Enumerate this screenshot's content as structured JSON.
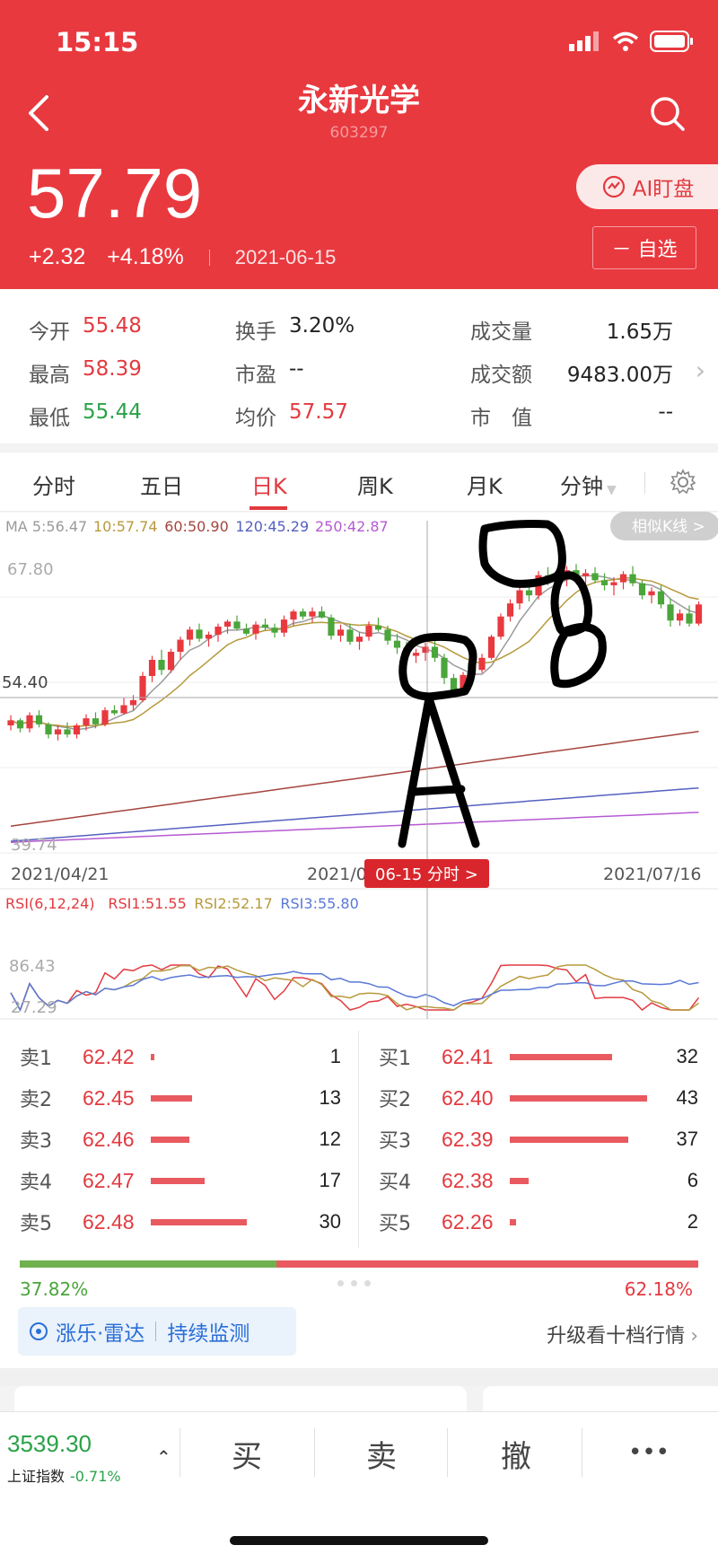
{
  "status": {
    "time": "15:15"
  },
  "header": {
    "title": "永新光学",
    "code": "603297",
    "price": "57.79",
    "change": "+2.32",
    "change_pct": "+4.18%",
    "date": "2021-06-15",
    "ai_button": "AI盯盘",
    "watch_button": "－ 自选"
  },
  "stats": {
    "open_label": "今开",
    "open": "55.48",
    "high_label": "最高",
    "high": "58.39",
    "low_label": "最低",
    "low": "55.44",
    "turnover_label": "换手",
    "turnover": "3.20%",
    "pe_label": "市盈",
    "pe": "--",
    "avg_label": "均价",
    "avg": "57.57",
    "volume_label": "成交量",
    "volume": "1.65万",
    "amount_label": "成交额",
    "amount": "9483.00万",
    "mcap_label": "市　值",
    "mcap": "--"
  },
  "tabs": [
    "分时",
    "五日",
    "日K",
    "周K",
    "月K",
    "分钟"
  ],
  "chart_data": [
    {
      "type": "candlestick",
      "ma_legend": [
        {
          "label": "MA 5:56.47",
          "color": "#9a9a9a"
        },
        {
          "label": "10:57.74",
          "color": "#b69a3c"
        },
        {
          "label": "60:50.90",
          "color": "#a5453f"
        },
        {
          "label": "120:45.29",
          "color": "#5660c0"
        },
        {
          "label": "250:42.87",
          "color": "#b65ad3"
        }
      ],
      "y_ticks": [
        "67.80",
        "54.40",
        "39.74"
      ],
      "x_ticks": [
        "2021/04/21",
        "2021/0",
        "2021/07/16"
      ],
      "crosshair_label": "06-15 分时 >",
      "similar_button": "相似K线 >",
      "candles": [
        [
          51.5,
          52.5,
          51.0,
          52.0
        ],
        [
          52.0,
          52.2,
          50.8,
          51.2
        ],
        [
          51.2,
          52.8,
          50.8,
          52.5
        ],
        [
          52.5,
          53.0,
          51.3,
          51.6
        ],
        [
          51.6,
          51.8,
          50.2,
          50.6
        ],
        [
          50.6,
          51.5,
          50.0,
          51.1
        ],
        [
          51.1,
          51.8,
          50.3,
          50.6
        ],
        [
          50.6,
          51.7,
          50.2,
          51.5
        ],
        [
          51.5,
          52.6,
          51.0,
          52.2
        ],
        [
          52.2,
          52.8,
          51.2,
          51.6
        ],
        [
          51.6,
          53.3,
          51.4,
          53.0
        ],
        [
          53.0,
          53.5,
          52.5,
          52.7
        ],
        [
          52.7,
          54.2,
          52.6,
          53.5
        ],
        [
          53.5,
          54.5,
          53.0,
          54.0
        ],
        [
          54.0,
          56.8,
          53.8,
          56.4
        ],
        [
          56.4,
          58.4,
          55.8,
          58.0
        ],
        [
          58.0,
          59.0,
          56.5,
          57.0
        ],
        [
          57.0,
          59.1,
          56.7,
          58.8
        ],
        [
          58.8,
          60.3,
          58.0,
          60.0
        ],
        [
          60.0,
          61.3,
          59.4,
          61.0
        ],
        [
          61.0,
          61.6,
          59.8,
          60.1
        ],
        [
          60.1,
          60.8,
          59.3,
          60.5
        ],
        [
          60.5,
          61.6,
          59.8,
          61.3
        ],
        [
          61.3,
          62.0,
          60.6,
          61.8
        ],
        [
          61.8,
          62.4,
          60.9,
          61.1
        ],
        [
          61.1,
          61.6,
          60.4,
          60.6
        ],
        [
          60.6,
          61.8,
          60.0,
          61.5
        ],
        [
          61.5,
          62.1,
          60.9,
          61.2
        ],
        [
          61.2,
          61.6,
          60.2,
          60.7
        ],
        [
          60.7,
          62.4,
          60.3,
          62.0
        ],
        [
          62.0,
          63.0,
          61.4,
          62.8
        ],
        [
          62.8,
          63.1,
          62.0,
          62.3
        ],
        [
          62.3,
          63.2,
          61.7,
          62.8
        ],
        [
          62.8,
          63.3,
          62.1,
          62.2
        ],
        [
          62.2,
          62.5,
          60.0,
          60.4
        ],
        [
          60.4,
          61.5,
          59.8,
          61.0
        ],
        [
          61.0,
          61.6,
          59.5,
          59.8
        ],
        [
          59.8,
          60.7,
          59.0,
          60.3
        ],
        [
          60.3,
          61.8,
          59.9,
          61.4
        ],
        [
          61.4,
          62.2,
          60.8,
          61.0
        ],
        [
          61.0,
          61.4,
          59.5,
          59.9
        ],
        [
          59.9,
          60.6,
          58.6,
          59.2
        ],
        [
          59.2,
          59.8,
          57.8,
          58.4
        ],
        [
          58.4,
          59.1,
          57.7,
          58.7
        ],
        [
          58.7,
          59.7,
          57.9,
          59.3
        ],
        [
          59.3,
          59.9,
          57.8,
          58.2
        ],
        [
          58.2,
          58.6,
          55.6,
          56.2
        ],
        [
          56.2,
          56.6,
          54.5,
          55.0
        ],
        [
          55.0,
          56.8,
          54.8,
          56.5
        ],
        [
          56.5,
          57.8,
          56.0,
          57.0
        ],
        [
          57.0,
          58.6,
          56.7,
          58.2
        ],
        [
          58.2,
          60.5,
          58.0,
          60.3
        ],
        [
          60.3,
          62.6,
          60.0,
          62.3
        ],
        [
          62.3,
          64.0,
          61.8,
          63.6
        ],
        [
          63.6,
          65.2,
          63.0,
          64.9
        ],
        [
          64.9,
          65.6,
          63.8,
          64.4
        ],
        [
          64.4,
          66.8,
          64.0,
          66.4
        ],
        [
          66.4,
          67.2,
          65.4,
          65.8
        ],
        [
          65.8,
          66.5,
          65.0,
          66.1
        ],
        [
          66.1,
          67.3,
          65.3,
          66.9
        ],
        [
          66.9,
          67.5,
          65.8,
          66.3
        ],
        [
          66.3,
          67.0,
          65.4,
          66.6
        ],
        [
          66.6,
          67.2,
          65.6,
          65.9
        ],
        [
          65.9,
          66.6,
          64.9,
          65.4
        ],
        [
          65.4,
          66.2,
          64.4,
          65.7
        ],
        [
          65.7,
          66.8,
          65.0,
          66.5
        ],
        [
          66.5,
          67.3,
          65.3,
          65.6
        ],
        [
          65.6,
          65.9,
          64.0,
          64.4
        ],
        [
          64.4,
          65.2,
          63.6,
          64.8
        ],
        [
          64.8,
          65.4,
          63.1,
          63.5
        ],
        [
          63.5,
          64.1,
          61.3,
          61.9
        ],
        [
          61.9,
          63.0,
          61.4,
          62.6
        ],
        [
          62.6,
          63.4,
          61.3,
          61.6
        ],
        [
          61.6,
          63.8,
          61.4,
          63.5
        ]
      ]
    },
    {
      "type": "line",
      "legend": [
        {
          "label": "RSI(6,12,24)",
          "color": "#e23a40"
        },
        {
          "label": "RSI1:51.55",
          "color": "#e23a40"
        },
        {
          "label": "RSI2:52.17",
          "color": "#b69a3c"
        },
        {
          "label": "RSI3:55.80",
          "color": "#5a78d6"
        }
      ],
      "y_ticks": [
        "86.43",
        "27.29"
      ]
    }
  ],
  "orderbook": {
    "asks": [
      {
        "label": "卖1",
        "price": "62.42",
        "vol": 1
      },
      {
        "label": "卖2",
        "price": "62.45",
        "vol": 13
      },
      {
        "label": "卖3",
        "price": "62.46",
        "vol": 12
      },
      {
        "label": "卖4",
        "price": "62.47",
        "vol": 17
      },
      {
        "label": "卖5",
        "price": "62.48",
        "vol": 30
      }
    ],
    "bids": [
      {
        "label": "买1",
        "price": "62.41",
        "vol": 32
      },
      {
        "label": "买2",
        "price": "62.40",
        "vol": 43
      },
      {
        "label": "买3",
        "price": "62.39",
        "vol": 37
      },
      {
        "label": "买4",
        "price": "62.38",
        "vol": 6
      },
      {
        "label": "买5",
        "price": "62.26",
        "vol": 2
      }
    ],
    "sell_ratio": "37.82%",
    "buy_ratio": "62.18%",
    "sell_fraction": 0.3782,
    "radar_label": "涨乐·雷达",
    "radar_action": "持续监测",
    "upgrade_label": "升级看十档行情"
  },
  "bottom": {
    "index_value": "3539.30",
    "index_name": "上证指数",
    "index_pct": "-0.71%",
    "buy": "买",
    "sell": "卖",
    "cancel": "撤",
    "more": "•••"
  }
}
